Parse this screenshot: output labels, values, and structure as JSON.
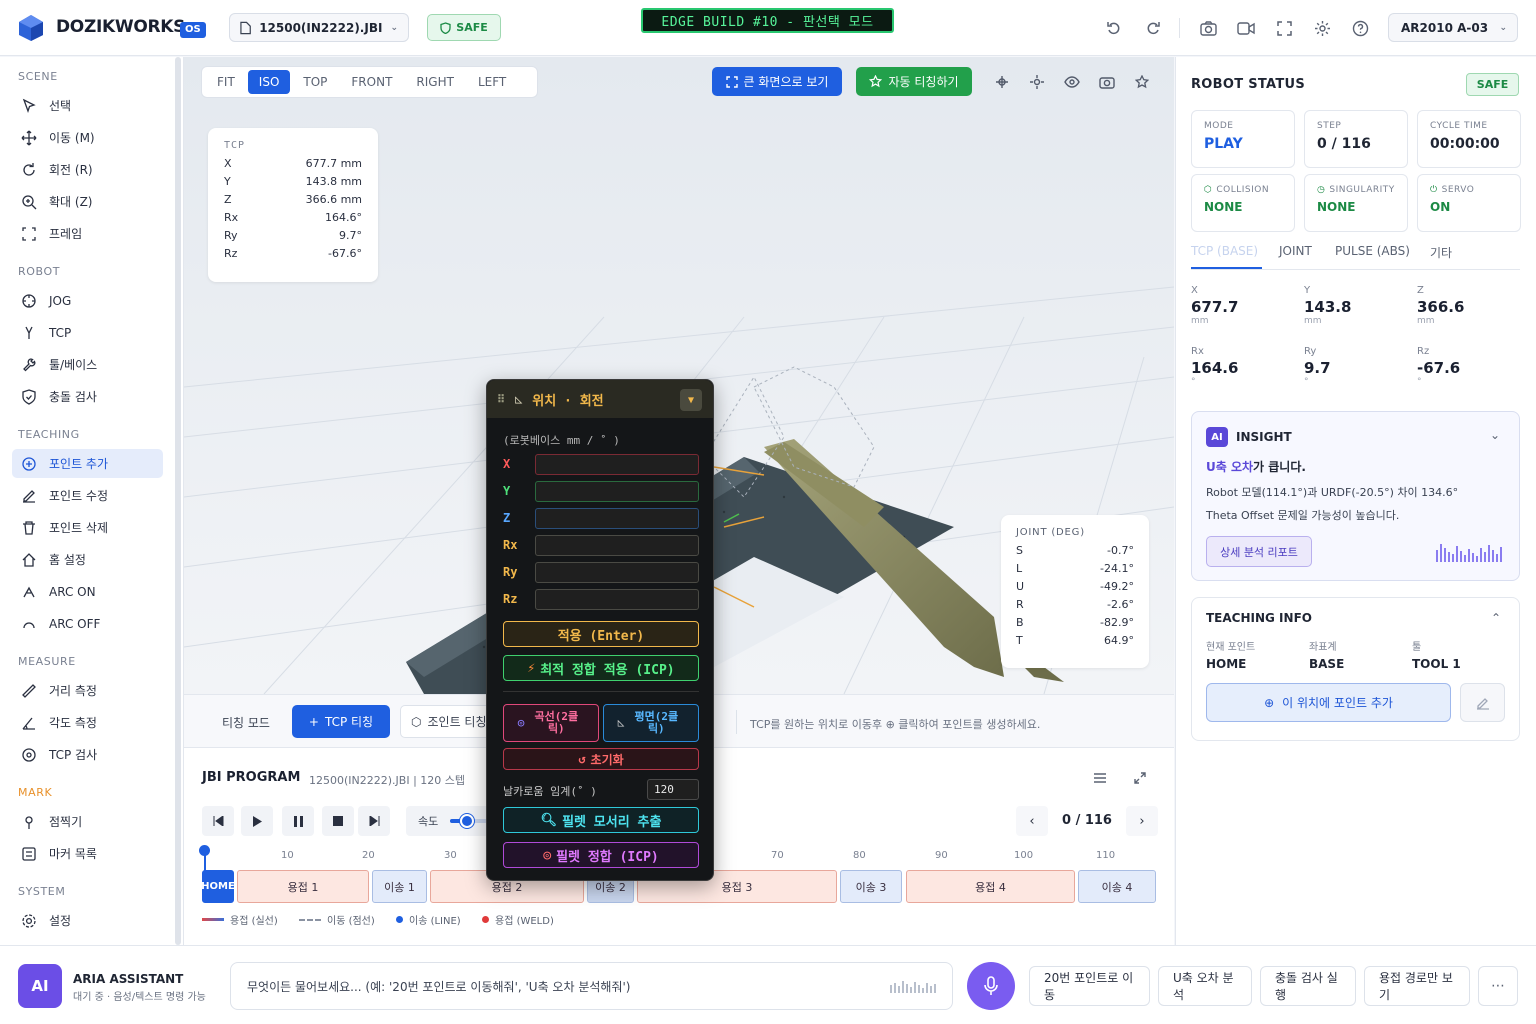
{
  "header": {
    "brand": "DOZIKWORKS",
    "os_badge": "OS",
    "file": "12500(IN2222).JBI",
    "safe": "SAFE",
    "build_banner": "EDGE BUILD #10 - 판선택 모드",
    "robot": "AR2010 A-03"
  },
  "sidebar": {
    "sections": [
      {
        "title": "SCENE",
        "items": [
          "선택",
          "이동 (M)",
          "회전 (R)",
          "확대 (Z)",
          "프레임"
        ]
      },
      {
        "title": "ROBOT",
        "items": [
          "JOG",
          "TCP",
          "툴/베이스",
          "충돌 검사"
        ]
      },
      {
        "title": "TEACHING",
        "items": [
          "포인트 추가",
          "포인트 수정",
          "포인트 삭제",
          "홈 설정",
          "ARC ON",
          "ARC OFF"
        ]
      },
      {
        "title": "MEASURE",
        "items": [
          "거리 측정",
          "각도 측정",
          "TCP 검사"
        ]
      },
      {
        "title": "MARK",
        "items": [
          "점찍기",
          "마커 목록"
        ]
      },
      {
        "title": "SYSTEM",
        "items": [
          "설정"
        ]
      }
    ]
  },
  "viewport": {
    "views": [
      "FIT",
      "ISO",
      "TOP",
      "FRONT",
      "RIGHT",
      "LEFT"
    ],
    "active_view": "ISO",
    "fullscreen_label": "큰 화면으로 보기",
    "auto_label": "자동 티칭하기",
    "tcp_card": {
      "title": "TCP",
      "rows": [
        {
          "k": "X",
          "v": "677.7 mm"
        },
        {
          "k": "Y",
          "v": "143.8 mm"
        },
        {
          "k": "Z",
          "v": "366.6 mm"
        },
        {
          "k": "Rx",
          "v": "164.6°"
        },
        {
          "k": "Ry",
          "v": "9.7°"
        },
        {
          "k": "Rz",
          "v": "-67.6°"
        }
      ]
    },
    "joint_card": {
      "title": "JOINT (DEG)",
      "rows": [
        {
          "k": "S",
          "v": "-0.7°"
        },
        {
          "k": "L",
          "v": "-24.1°"
        },
        {
          "k": "U",
          "v": "-49.2°"
        },
        {
          "k": "R",
          "v": "-2.6°"
        },
        {
          "k": "B",
          "v": "-82.9°"
        },
        {
          "k": "T",
          "v": "64.9°"
        }
      ]
    }
  },
  "popup": {
    "title": "위치 · 회전",
    "unit": "(로봇베이스 mm / ˚ )",
    "fields": [
      "X",
      "Y",
      "Z",
      "Rx",
      "Ry",
      "Rz"
    ],
    "apply": "적용 (Enter)",
    "icp_apply": "최적 정합 적용 (ICP)",
    "curve": "곡선(2클릭)",
    "plane": "평면(2클릭)",
    "reset": "초기화",
    "threshold_label": "날카로움 임계(˚ )",
    "threshold_value": "120",
    "fillet_extract": "필렛 모서리 추출",
    "fillet_icp": "필렛 정합 (ICP)"
  },
  "teach": {
    "mode_label": "티칭 모드",
    "tcp_btn": "TCP 티칭",
    "joint_btn": "조인트 티칭",
    "hint": "TCP를 원하는 위치로 이동후 ⊕ 클릭하여 포인트를 생성하세요."
  },
  "program": {
    "title": "JBI PROGRAM",
    "subtitle": "12500(IN2222).JBI | 120 스텝",
    "speed_label": "속도",
    "speed_fraction": 0.1,
    "step_display": "0 / 116",
    "ticks": [
      "10",
      "20",
      "30",
      "70",
      "80",
      "90",
      "100",
      "110"
    ],
    "segments": [
      {
        "label": "HOME",
        "type": "home"
      },
      {
        "label": "용접 1",
        "type": "weld"
      },
      {
        "label": "이송 1",
        "type": "move"
      },
      {
        "label": "용접 2",
        "type": "weld"
      },
      {
        "label": "이송 2",
        "type": "move"
      },
      {
        "label": "용접 3",
        "type": "weld"
      },
      {
        "label": "이송 3",
        "type": "move"
      },
      {
        "label": "용접 4",
        "type": "weld"
      },
      {
        "label": "이송 4",
        "type": "move"
      }
    ],
    "legend": [
      "용접 (실선)",
      "이동 (점선)",
      "이송 (LINE)",
      "용접 (WELD)"
    ]
  },
  "status": {
    "title": "ROBOT STATUS",
    "badge": "SAFE",
    "cards": [
      {
        "label": "MODE",
        "value": "PLAY"
      },
      {
        "label": "STEP",
        "value": "0 / 116"
      },
      {
        "label": "CYCLE TIME",
        "value": "00:00:00"
      },
      {
        "label": "COLLISION",
        "value": "NONE"
      },
      {
        "label": "SINGULARITY",
        "value": "NONE"
      },
      {
        "label": "SERVO",
        "value": "ON"
      }
    ],
    "tabs": [
      "TCP (BASE)",
      "JOINT",
      "PULSE (ABS)",
      "기타"
    ],
    "coords": [
      {
        "k": "X",
        "v": "677.7",
        "u": "mm"
      },
      {
        "k": "Y",
        "v": "143.8",
        "u": "mm"
      },
      {
        "k": "Z",
        "v": "366.6",
        "u": "mm"
      },
      {
        "k": "Rx",
        "v": "164.6",
        "u": "°"
      },
      {
        "k": "Ry",
        "v": "9.7",
        "u": "°"
      },
      {
        "k": "Rz",
        "v": "-67.6",
        "u": "°"
      }
    ]
  },
  "insight": {
    "badge": "AI",
    "title": "INSIGHT",
    "headline_strong": "U축 오차",
    "headline_rest": "가 큽니다.",
    "line1": "Robot 모델(114.1°)과 URDF(-20.5°) 차이 134.6°",
    "line2": "Theta Offset 문제일 가능성이 높습니다.",
    "report_btn": "상세 분석 리포트"
  },
  "teaching_info": {
    "title": "TEACHING INFO",
    "cols": [
      {
        "k": "현재 포인트",
        "v": "HOME"
      },
      {
        "k": "좌표계",
        "v": "BASE"
      },
      {
        "k": "툴",
        "v": "TOOL 1"
      }
    ],
    "add_btn": "이 위치에 포인트 추가"
  },
  "assistant": {
    "badge": "AI",
    "name": "ARIA ASSISTANT",
    "status": "대기 중 · 음성/텍스트 명령 가능",
    "placeholder": "무엇이든 물어보세요... (예: '20번 포인트로 이동해줘', 'U축 오차 분석해줘')",
    "quick": [
      "20번 포인트로 이동",
      "U축 오차 분석",
      "충돌 검사 실행",
      "용접 경로만 보기"
    ]
  },
  "colors": {
    "accent": "#1f5fe0",
    "success": "#22a04b",
    "warn": "#f2b84b"
  }
}
